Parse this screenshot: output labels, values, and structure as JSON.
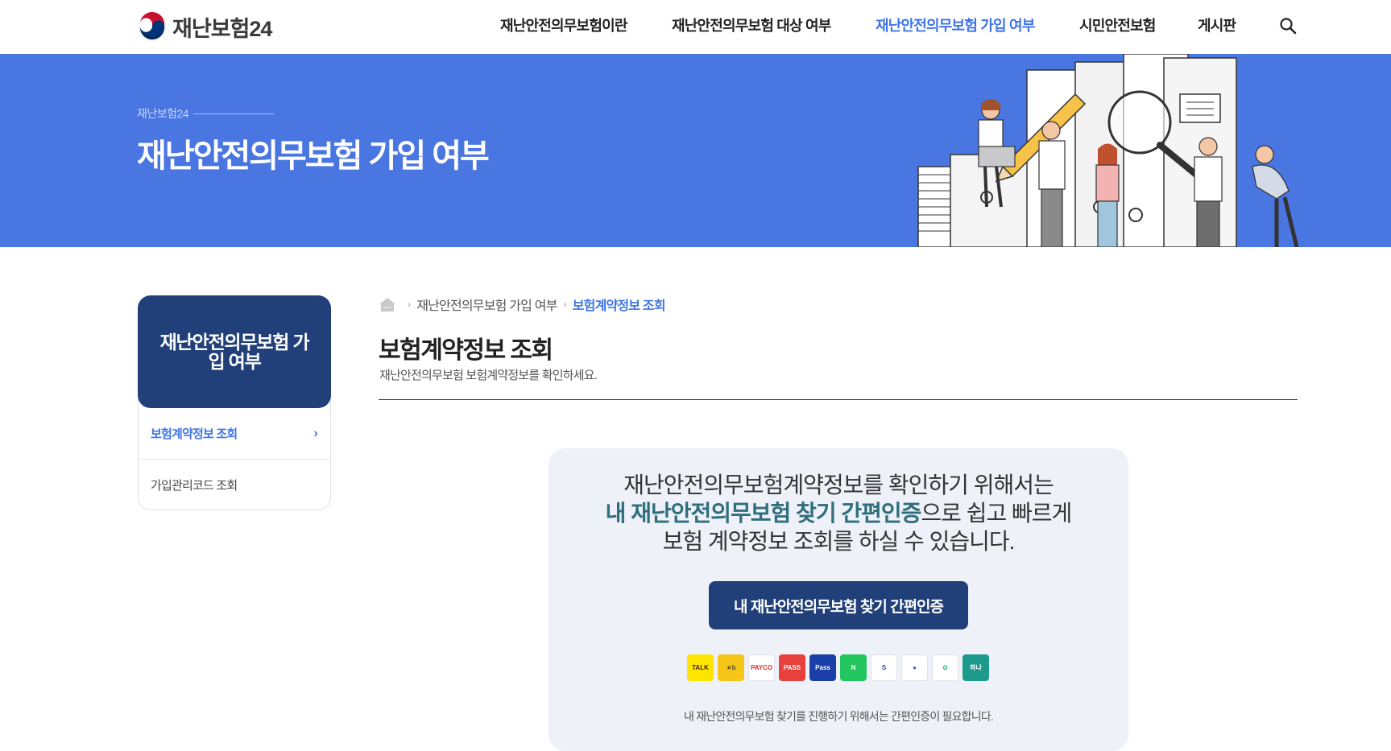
{
  "header": {
    "logo_text": "재난보험24",
    "nav": [
      {
        "label": "재난안전의무보험이란"
      },
      {
        "label": "재난안전의무보험 대상 여부"
      },
      {
        "label": "재난안전의무보험 가입 여부"
      },
      {
        "label": "시민안전보험"
      },
      {
        "label": "게시판"
      }
    ],
    "active_nav_index": 2
  },
  "banner": {
    "subtitle": "재난보험24",
    "title": "재난안전의무보험 가입 여부",
    "background_color": "#4a76e2"
  },
  "sidebar": {
    "title": "재난안전의무보험 가입 여부",
    "items": [
      {
        "label": "보험계약정보 조회",
        "active": true
      },
      {
        "label": "가입관리코드 조회",
        "active": false
      }
    ]
  },
  "breadcrumb": {
    "items": [
      "재난안전의무보험 가입 여부"
    ],
    "current": "보험계약정보 조회"
  },
  "page": {
    "title": "보험계약정보 조회",
    "description": "재난안전의무보험 보험계약정보를 확인하세요."
  },
  "auth": {
    "lead_line1": "재난안전의무보험계약정보를 확인하기 위해서는",
    "lead_highlight": "내 재난안전의무보험 찾기 간편인증",
    "lead_line2_rest": "으로 쉽고 빠르게",
    "lead_line3": "보험 계약정보 조회를 하실 수 있습니다.",
    "button_label": "내 재난안전의무보험 찾기 간편인증",
    "providers": [
      {
        "name": "kakaotalk",
        "label": "TALK",
        "color": "#fee500",
        "text_color": "#3c1e1e"
      },
      {
        "name": "kb",
        "label": "★b",
        "color": "#f5c518",
        "text_color": "#5a4a3c"
      },
      {
        "name": "payco",
        "label": "PAYCO",
        "color": "#ffffff",
        "text_color": "#e42a2a"
      },
      {
        "name": "pass",
        "label": "PASS",
        "color": "#e8413d",
        "text_color": "#ffffff"
      },
      {
        "name": "samsung-pass",
        "label": "Pass",
        "color": "#1b3fa8",
        "text_color": "#ffffff"
      },
      {
        "name": "naver",
        "label": "N",
        "color": "#22c55e",
        "text_color": "#ffffff"
      },
      {
        "name": "shinhan",
        "label": "S",
        "color": "#ffffff",
        "text_color": "#1a4fb5"
      },
      {
        "name": "toss",
        "label": "●",
        "color": "#ffffff",
        "text_color": "#1f6df2"
      },
      {
        "name": "nh",
        "label": "✿",
        "color": "#ffffff",
        "text_color": "#26b36b"
      },
      {
        "name": "hana",
        "label": "하나",
        "color": "#1c9a8c",
        "text_color": "#ffffff"
      }
    ],
    "note": "내 재난안전의무보험 찾기를 진행하기 위해서는 간편인증이 필요합니다."
  }
}
